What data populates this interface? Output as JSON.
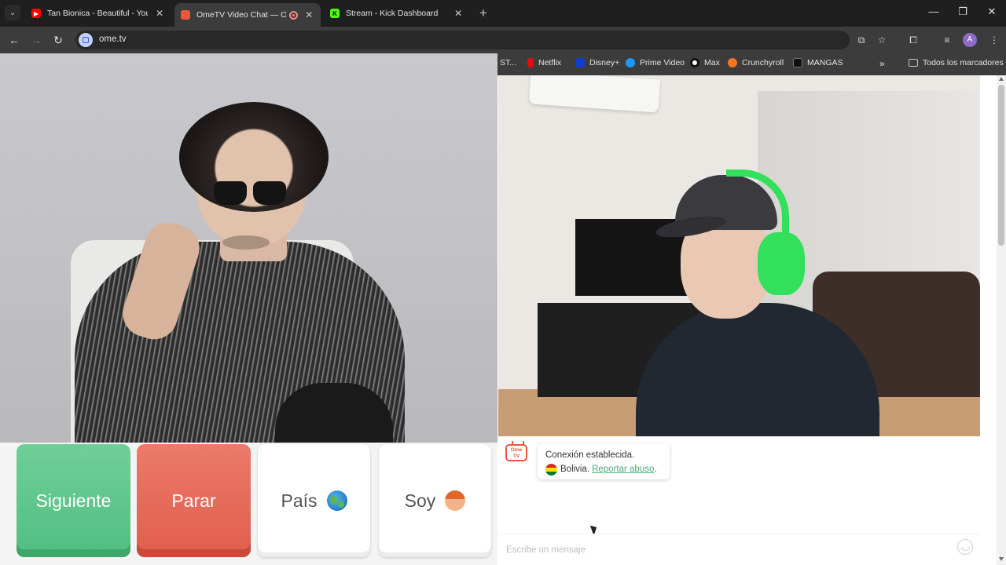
{
  "browser": {
    "tabs": [
      {
        "title": "Tan Bionica - Beautiful - YouTube",
        "favicon": "youtube-icon",
        "color": "#ff0000"
      },
      {
        "title": "OmeTV Video Chat — OmeTV",
        "favicon": "ometv-icon",
        "color": "#e9573f",
        "active": true
      },
      {
        "title": "Stream - Kick Dashboard",
        "favicon": "kick-icon",
        "color": "#53fc18"
      }
    ],
    "url": "ome.tv"
  },
  "bookmarks": [
    {
      "label": "ST...",
      "icon": "bookmark-icon",
      "color": "#888888"
    },
    {
      "label": "Netflix",
      "icon": "netflix-icon",
      "color": "#e50914"
    },
    {
      "label": "Disney+",
      "icon": "disney-icon",
      "color": "#113ccf"
    },
    {
      "label": "Prime Video",
      "icon": "prime-video-icon",
      "color": "#1a98ff"
    },
    {
      "label": "Max",
      "icon": "max-icon",
      "color": "#ffffff"
    },
    {
      "label": "Crunchyroll",
      "icon": "crunchyroll-icon",
      "color": "#f47521"
    },
    {
      "label": "MANGAS",
      "icon": "mangas-icon",
      "color": "#111111"
    }
  ],
  "all_bookmarks": "Todos los marcadores",
  "controls": {
    "next": "Siguiente",
    "stop": "Parar",
    "country": "País",
    "gender": "Soy"
  },
  "chat": {
    "status": "Conexión establecida.",
    "country": "Bolivia.",
    "report": "Reportar abuso",
    "report_suffix": ".",
    "input_placeholder": "Escribe un mensaje"
  },
  "colors": {
    "next_button": "#52be81",
    "stop_button": "#e05e4c",
    "link": "#4aa972"
  }
}
